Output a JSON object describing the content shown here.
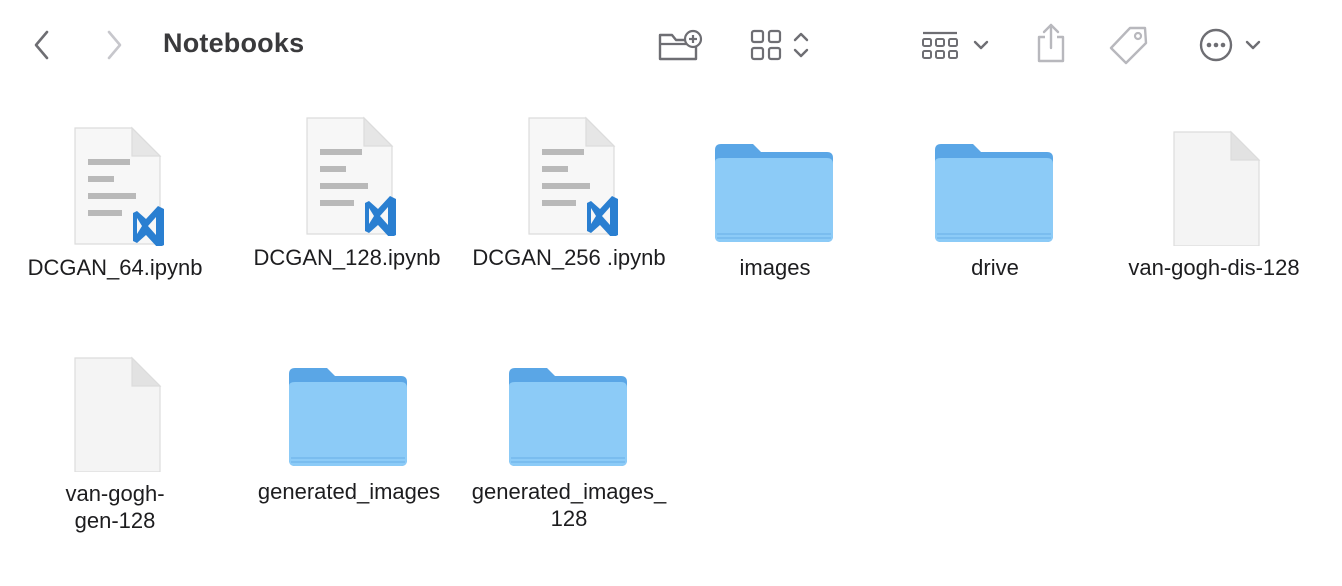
{
  "window": {
    "title": "Notebooks"
  },
  "toolbar": {
    "back": "chevron-left-icon",
    "forward": "chevron-right-icon",
    "new_folder": "folder-plus-icon",
    "view_mode": "icon-grid-icon",
    "group_by": "group-icon",
    "share": "share-icon",
    "tags": "tag-icon",
    "more": "ellipsis-circle-icon"
  },
  "files": [
    {
      "name": "DCGAN_64.ipynb",
      "type": "notebook"
    },
    {
      "name": "DCGAN_128.ipynb",
      "type": "notebook"
    },
    {
      "name": "DCGAN_256 .ipynb",
      "type": "notebook"
    },
    {
      "name": "images",
      "type": "folder"
    },
    {
      "name": "drive",
      "type": "folder"
    },
    {
      "name": "van-gogh-dis-128",
      "type": "document"
    },
    {
      "name": "van-gogh-gen-128",
      "type": "document"
    },
    {
      "name": "generated_images",
      "type": "folder"
    },
    {
      "name": "generated_images_128",
      "type": "folder"
    }
  ],
  "colors": {
    "folder_front": "#8ccbf7",
    "folder_back": "#5aa6e6",
    "vscode_blue": "#2a7fd1",
    "toolbar_icon": "#6e6e73"
  }
}
